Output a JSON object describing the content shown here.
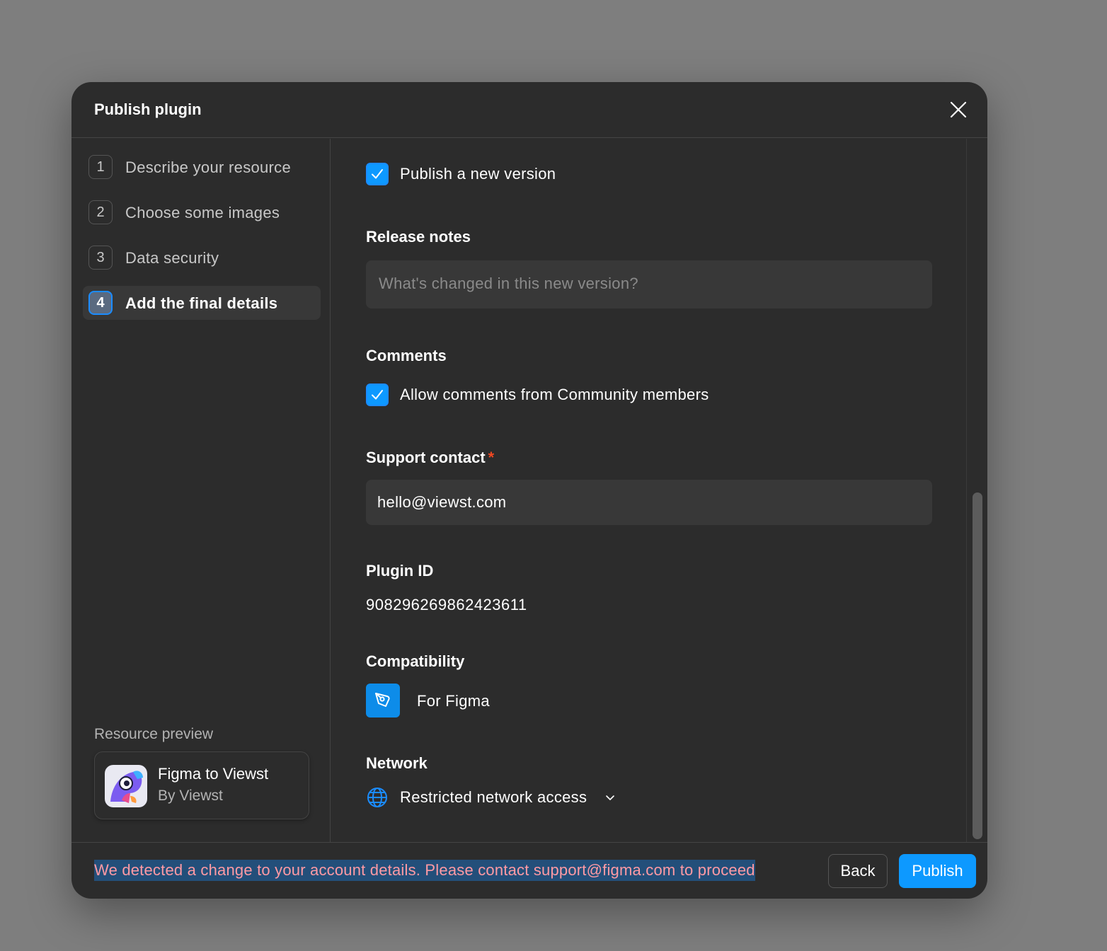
{
  "modal": {
    "title": "Publish plugin"
  },
  "sidebar": {
    "steps": [
      {
        "number": "1",
        "label": "Describe your resource"
      },
      {
        "number": "2",
        "label": "Choose some images"
      },
      {
        "number": "3",
        "label": "Data security"
      },
      {
        "number": "4",
        "label": "Add the final details",
        "active": true
      }
    ],
    "preview": {
      "label": "Resource preview",
      "name": "Figma to Viewst",
      "author": "By Viewst"
    }
  },
  "content": {
    "publish_new_version": {
      "label": "Publish a new version",
      "checked": true
    },
    "release_notes": {
      "label": "Release notes",
      "placeholder": "What's changed in this new version?",
      "value": ""
    },
    "comments": {
      "label": "Comments",
      "allow_label": "Allow comments from Community members",
      "checked": true
    },
    "support_contact": {
      "label": "Support contact",
      "required_mark": "*",
      "value": "hello@viewst.com"
    },
    "plugin_id": {
      "label": "Plugin ID",
      "value": "908296269862423611"
    },
    "compatibility": {
      "label": "Compatibility",
      "value": "For Figma",
      "icon": "figma-pen-icon"
    },
    "network": {
      "label": "Network",
      "value": "Restricted network access",
      "icon": "globe-icon"
    }
  },
  "footer": {
    "warning": "We detected a change to your account details. Please contact support@figma.com to proceed",
    "back_label": "Back",
    "publish_label": "Publish"
  },
  "colors": {
    "background": "#7e7e7e",
    "modal": "#2c2c2c",
    "accent": "#0d99ff",
    "warning_text": "#ff9aa4",
    "warning_highlight": "#234f7a",
    "required": "#f24822"
  }
}
